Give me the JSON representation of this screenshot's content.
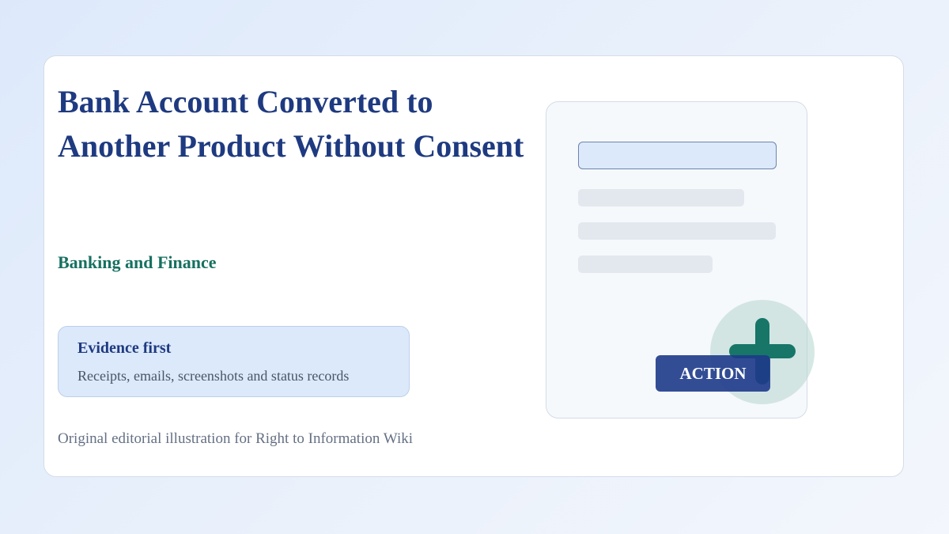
{
  "title": {
    "line1": "Bank Account Converted to",
    "line2": "Another Product Without Consent"
  },
  "category": "Banking and Finance",
  "evidence": {
    "title": "Evidence first",
    "text": "Receipts, emails, screenshots and status records"
  },
  "credit": "Original editorial illustration for Right to Information Wiki",
  "illustration": {
    "action_label": "ACTION",
    "icon": "plus-icon"
  },
  "colors": {
    "title": "#1e3a80",
    "category": "#167060",
    "accent_green": "#177668",
    "action_bg": "#1e3a8a",
    "evidence_bg": "#dce9fb"
  }
}
